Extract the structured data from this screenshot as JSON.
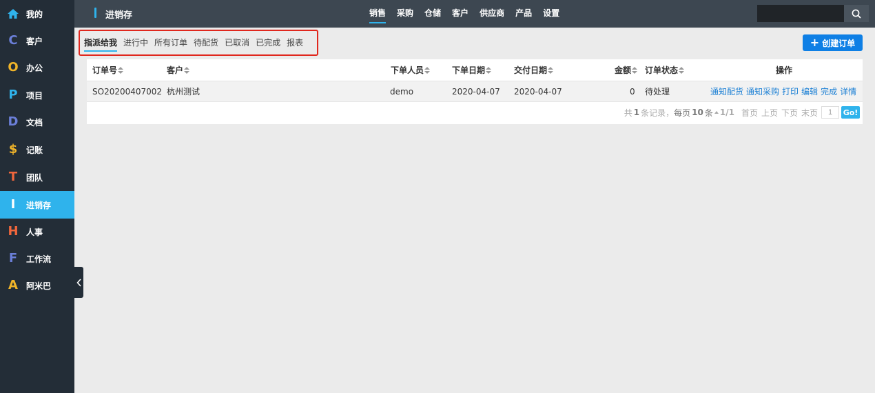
{
  "sidebar": {
    "items": [
      {
        "icon": "home-icon",
        "glyph": "",
        "color": "#2fb3ec",
        "label": "我的"
      },
      {
        "icon": "letter-c-icon",
        "glyph": "C",
        "color": "#6b7fd8",
        "label": "客户"
      },
      {
        "icon": "letter-o-icon",
        "glyph": "O",
        "color": "#f0b429",
        "label": "办公"
      },
      {
        "icon": "letter-p-icon",
        "glyph": "P",
        "color": "#2fb3ec",
        "label": "项目"
      },
      {
        "icon": "letter-d-icon",
        "glyph": "D",
        "color": "#6b7fd8",
        "label": "文档"
      },
      {
        "icon": "dollar-icon",
        "glyph": "$",
        "color": "#f0b429",
        "label": "记账"
      },
      {
        "icon": "letter-t-icon",
        "glyph": "T",
        "color": "#f0663c",
        "label": "团队"
      },
      {
        "icon": "letter-i-icon",
        "glyph": "I",
        "color": "#ffffff",
        "label": "进销存"
      },
      {
        "icon": "letter-h-icon",
        "glyph": "H",
        "color": "#f0663c",
        "label": "人事"
      },
      {
        "icon": "letter-f-icon",
        "glyph": "F",
        "color": "#6b7fd8",
        "label": "工作流"
      },
      {
        "icon": "letter-a-icon",
        "glyph": "A",
        "color": "#f0b429",
        "label": "阿米巴"
      }
    ],
    "active_index": 7
  },
  "header": {
    "app_title": "进销存",
    "nav": [
      "销售",
      "采购",
      "仓储",
      "客户",
      "供应商",
      "产品",
      "设置"
    ],
    "active_nav": 0,
    "search_value": ""
  },
  "subtabs": {
    "items": [
      "指派给我",
      "进行中",
      "所有订单",
      "待配货",
      "已取消",
      "已完成",
      "报表"
    ],
    "active_index": 0
  },
  "create_button": "创建订单",
  "table": {
    "columns": [
      "订单号",
      "客户",
      "下单人员",
      "下单日期",
      "交付日期",
      "金额",
      "订单状态",
      "操作"
    ],
    "rows": [
      {
        "order_no": "SO20200407002",
        "customer": "杭州测试",
        "creator": "demo",
        "order_date": "2020-04-07",
        "delivery_date": "2020-04-07",
        "amount": "0",
        "status": "待处理",
        "actions": [
          "通知配货",
          "通知采购",
          "打印",
          "编辑",
          "完成",
          "详情"
        ]
      }
    ]
  },
  "pager": {
    "prefix": "共",
    "total": "1",
    "total_suffix": "条记录，",
    "per_page_prefix": "每页",
    "per_page": "10",
    "per_page_suffix": "条",
    "page_info": "1/1",
    "first": "首页",
    "prev": "上页",
    "next": "下页",
    "last": "末页",
    "page_input": "1",
    "go": "Go!"
  },
  "colors": {
    "sidebar_bg": "#232d37",
    "header_bg": "#3d4751",
    "accent": "#2fb3ec",
    "primary_button": "#0e7fe5",
    "highlight_border": "#e0271d",
    "link": "#1a7fd4"
  }
}
